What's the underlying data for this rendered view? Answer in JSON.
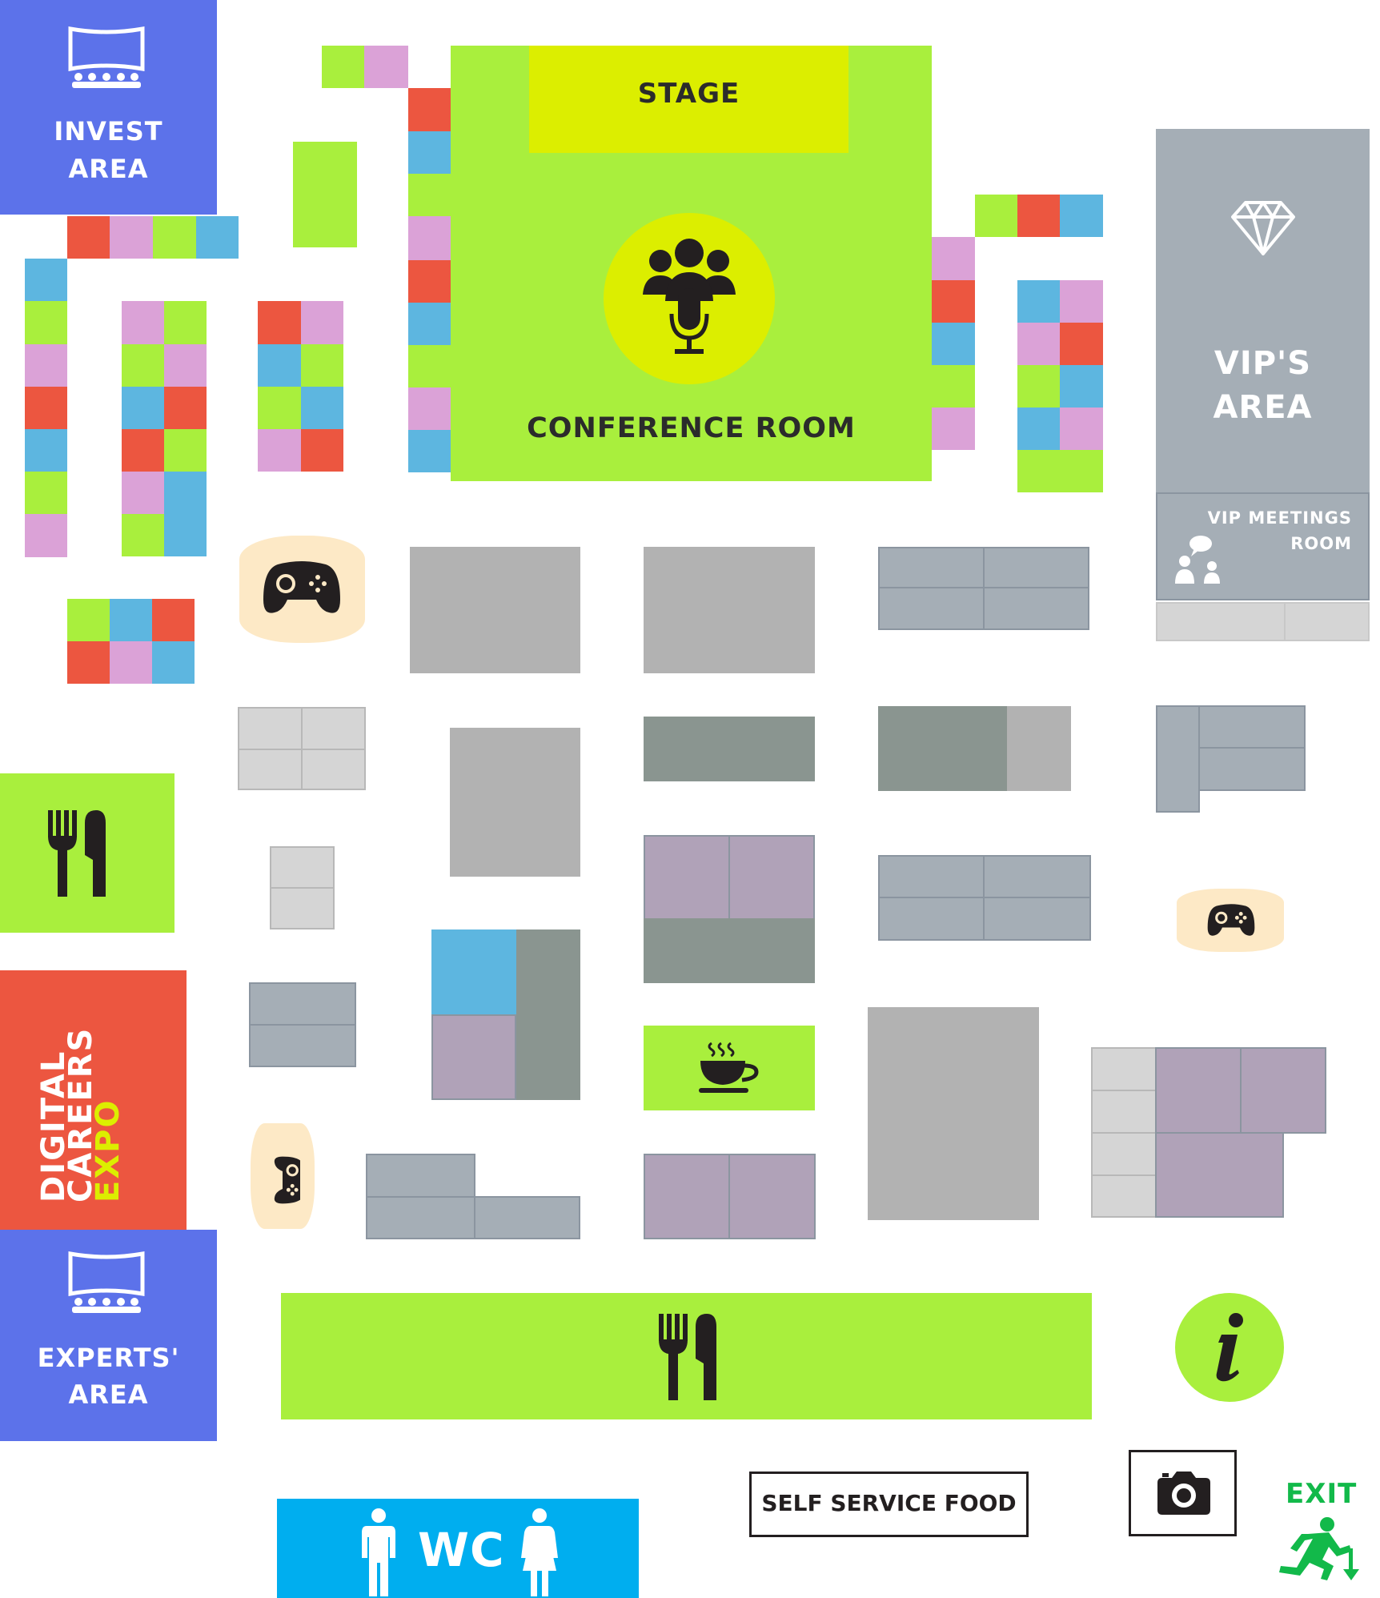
{
  "zones": {
    "invest": {
      "line1": "INVEST",
      "line2": "AREA"
    },
    "stage": "STAGE",
    "conference": "CONFERENCE ROOM",
    "vip": {
      "line1": "VIP'S",
      "line2": "AREA"
    },
    "vip_meetings": {
      "line1": "VIP MEETINGS",
      "line2": "ROOM"
    },
    "digital_expo": {
      "line1": "DIGITAL",
      "line2": "CAREERS",
      "line3": "EXPO"
    },
    "experts": {
      "line1": "EXPERTS'",
      "line2": "AREA"
    },
    "self_service": "SELF SERVICE FOOD",
    "wc": "WC",
    "exit": "EXIT"
  },
  "icons": [
    "screen-audience-icon",
    "microphone-speakers-icon",
    "diamond-icon",
    "meeting-people-icon",
    "gamepad-icon",
    "fork-knife-icon",
    "coffee-cup-icon",
    "info-icon",
    "camera-icon",
    "man-icon",
    "woman-icon",
    "running-exit-icon"
  ],
  "colors": {
    "zone_blue": "#5c72ea",
    "lime": "#a9ef3d",
    "stage_yellow": "#dcee00",
    "expo_red": "#ec5640",
    "wc_blue": "#00aeef",
    "vip_gray": "#a5aeb6",
    "exit_green": "#12b94a"
  }
}
